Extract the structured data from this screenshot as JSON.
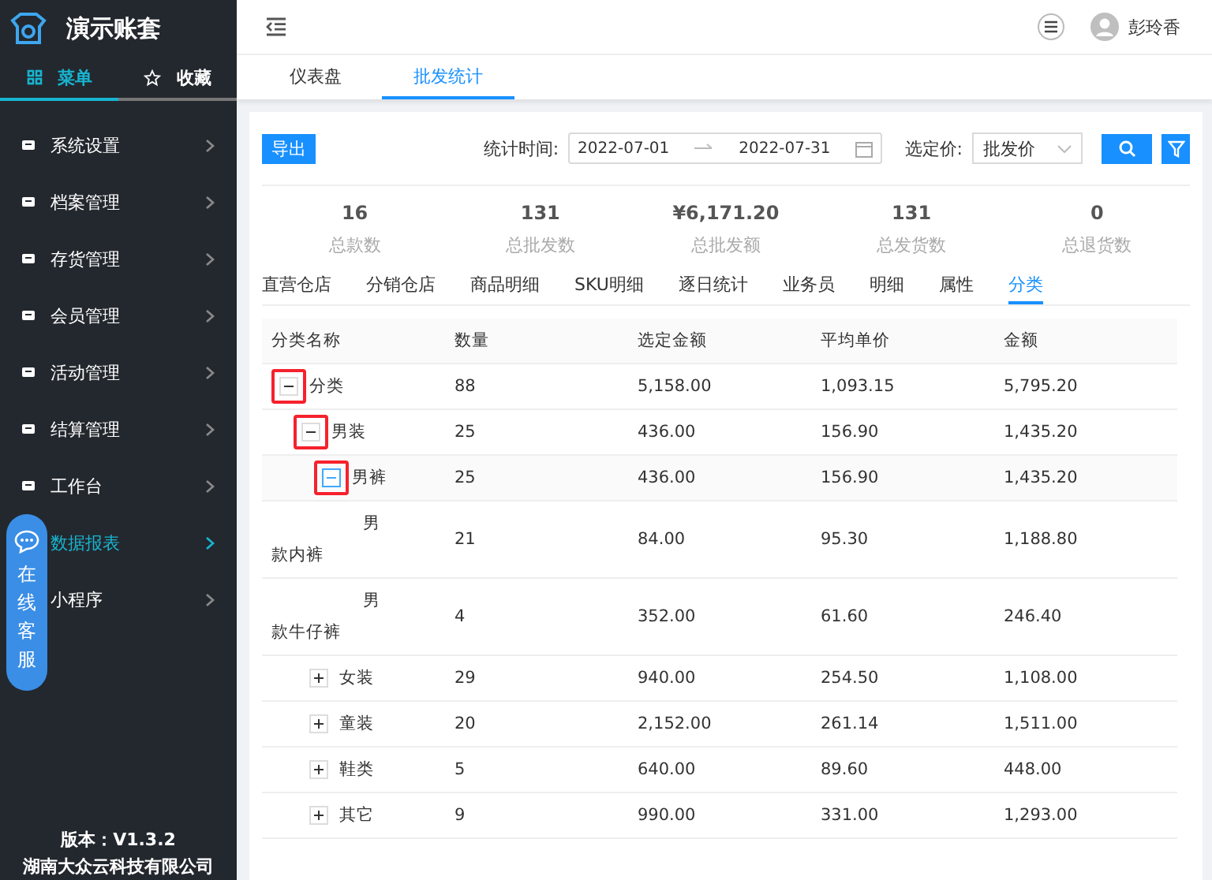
{
  "brand": {
    "title": "演示账套"
  },
  "sidebar_tabs": [
    {
      "label": "菜单",
      "selected": true,
      "kind": "grid"
    },
    {
      "label": "收藏",
      "selected": false,
      "kind": "star"
    }
  ],
  "sidebar": {
    "items": [
      {
        "label": "系统设置",
        "selected": false
      },
      {
        "label": "档案管理",
        "selected": false
      },
      {
        "label": "存货管理",
        "selected": false
      },
      {
        "label": "会员管理",
        "selected": false
      },
      {
        "label": "活动管理",
        "selected": false
      },
      {
        "label": "结算管理",
        "selected": false
      },
      {
        "label": "工作台",
        "selected": false
      },
      {
        "label": "数据报表",
        "selected": true,
        "has_icon": false
      },
      {
        "label": "小程序",
        "selected": false,
        "has_icon": false
      }
    ],
    "version": "版本：V1.3.2",
    "company": "湖南大众云科技有限公司"
  },
  "support_button": {
    "label": "在线客服"
  },
  "user": {
    "name": "彭玲香"
  },
  "page_tabs": [
    {
      "label": "仪表盘",
      "selected": false
    },
    {
      "label": "批发统计",
      "selected": true
    }
  ],
  "toolbar": {
    "export": "导出",
    "date_label": "统计时间:",
    "date_start": "2022-07-01",
    "date_end": "2022-07-31",
    "price_label": "选定价:",
    "price_value": "批发价"
  },
  "stats": [
    {
      "value": "16",
      "label": "总款数"
    },
    {
      "value": "131",
      "label": "总批发数"
    },
    {
      "value": "¥6,171.20",
      "label": "总批发额"
    },
    {
      "value": "131",
      "label": "总发货数"
    },
    {
      "value": "0",
      "label": "总退货数"
    }
  ],
  "report_tabs": [
    {
      "label": "直营仓店",
      "selected": false
    },
    {
      "label": "分销仓店",
      "selected": false
    },
    {
      "label": "商品明细",
      "selected": false
    },
    {
      "label": "SKU明细",
      "selected": false
    },
    {
      "label": "逐日统计",
      "selected": false
    },
    {
      "label": "业务员",
      "selected": false
    },
    {
      "label": "明细",
      "selected": false
    },
    {
      "label": "属性",
      "selected": false
    },
    {
      "label": "分类",
      "selected": true
    }
  ],
  "table": {
    "columns": [
      "分类名称",
      "数量",
      "选定金额",
      "平均单价",
      "金额"
    ],
    "rows": [
      {
        "cells": [
          "分类",
          "88",
          "5,158.00",
          "1,093.15",
          "5,795.20"
        ],
        "expanded": true,
        "highlighted": true,
        "children": [
          {
            "cells": [
              "男装",
              "25",
              "436.00",
              "156.90",
              "1,435.20"
            ],
            "expanded": true,
            "highlighted": true,
            "children": [
              {
                "cells": [
                  "男裤",
                  "25",
                  "436.00",
                  "156.90",
                  "1,435.20"
                ],
                "expanded": true,
                "highlighted": true,
                "children": [
                  {
                    "cells": [
                      "男款内裤",
                      "21",
                      "84.00",
                      "95.30",
                      "1,188.80"
                    ]
                  },
                  {
                    "cells": [
                      "男款牛仔裤",
                      "4",
                      "352.00",
                      "61.60",
                      "246.40"
                    ]
                  }
                ]
              }
            ]
          },
          {
            "cells": [
              "女装",
              "29",
              "940.00",
              "254.50",
              "1,108.00"
            ],
            "expanded": false,
            "highlighted": false
          },
          {
            "cells": [
              "童装",
              "20",
              "2,152.00",
              "261.14",
              "1,511.00"
            ],
            "expanded": false,
            "highlighted": false
          },
          {
            "cells": [
              "鞋类",
              "5",
              "640.00",
              "89.60",
              "448.00"
            ],
            "expanded": false,
            "highlighted": false
          },
          {
            "cells": [
              "其它",
              "9",
              "990.00",
              "331.00",
              "1,293.00"
            ],
            "expanded": false,
            "highlighted": false
          }
        ]
      }
    ]
  }
}
